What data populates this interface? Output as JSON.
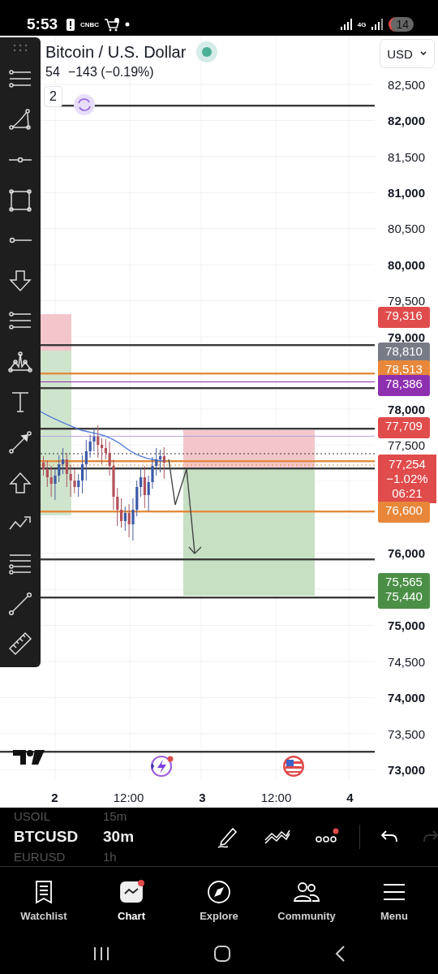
{
  "status_bar": {
    "time": "5:53",
    "news_logo": "CNBC",
    "network": "4G",
    "badge": "14"
  },
  "header": {
    "title": "Bitcoin / U.S. Dollar",
    "price_fragment": "54",
    "change": "−143 (−0.19%)",
    "legend_fragment": "2",
    "currency": "USD"
  },
  "price_axis": {
    "groups": [
      [
        {
          "label": "82,500",
          "major": false
        },
        {
          "label": "82,000",
          "major": true
        },
        {
          "label": "81,500",
          "major": false
        },
        {
          "label": "81,000",
          "major": true
        },
        {
          "label": "80,500",
          "major": false
        },
        {
          "label": "80,000",
          "major": true
        },
        {
          "label": "79,500",
          "major": false
        },
        {
          "label": "79,000",
          "major": true
        }
      ],
      [
        {
          "label": "78,000",
          "major": true
        },
        {
          "label": "77,500",
          "major": false
        }
      ],
      [
        {
          "label": "76,000",
          "major": true
        }
      ],
      [
        {
          "label": "75,000",
          "major": true
        },
        {
          "label": "74,500",
          "major": false
        },
        {
          "label": "74,000",
          "major": true
        },
        {
          "label": "73,500",
          "major": false
        },
        {
          "label": "73,000",
          "major": true
        }
      ]
    ]
  },
  "price_tags": [
    {
      "lines": [
        "79,316"
      ],
      "color": "#e04b4b"
    },
    {
      "lines": [
        "78,810"
      ],
      "color": "#787b86"
    },
    {
      "lines": [
        "78,513"
      ],
      "color": "#e8873a"
    },
    {
      "lines": [
        "78,386"
      ],
      "color": "#8e2fb0"
    },
    {
      "lines": [
        "77,709"
      ],
      "color": "#e04b4b"
    },
    {
      "lines": [
        "77,254",
        "−1.02%",
        "06:21"
      ],
      "color": "#e04b4b"
    },
    {
      "lines": [
        "76,600"
      ],
      "color": "#e8873a"
    },
    {
      "lines": [
        "75,565"
      ],
      "color": "#4a8f45"
    },
    {
      "lines": [
        "75,440"
      ],
      "color": "#4a8f45"
    }
  ],
  "time_axis": [
    {
      "label": "2",
      "major": true
    },
    {
      "label": "12:00",
      "major": false
    },
    {
      "label": "3",
      "major": true
    },
    {
      "label": "12:00",
      "major": false
    },
    {
      "label": "4",
      "major": true
    }
  ],
  "symbols": [
    {
      "symbol": "USOIL",
      "interval": "15m",
      "selected": false
    },
    {
      "symbol": "BTCUSD",
      "interval": "30m",
      "selected": true
    },
    {
      "symbol": "EURUSD",
      "interval": "1h",
      "selected": false
    }
  ],
  "nav": [
    {
      "label": "Watchlist",
      "selected": false
    },
    {
      "label": "Chart",
      "selected": true
    },
    {
      "label": "Explore",
      "selected": false
    },
    {
      "label": "Community",
      "selected": false
    },
    {
      "label": "Menu",
      "selected": false
    }
  ]
}
